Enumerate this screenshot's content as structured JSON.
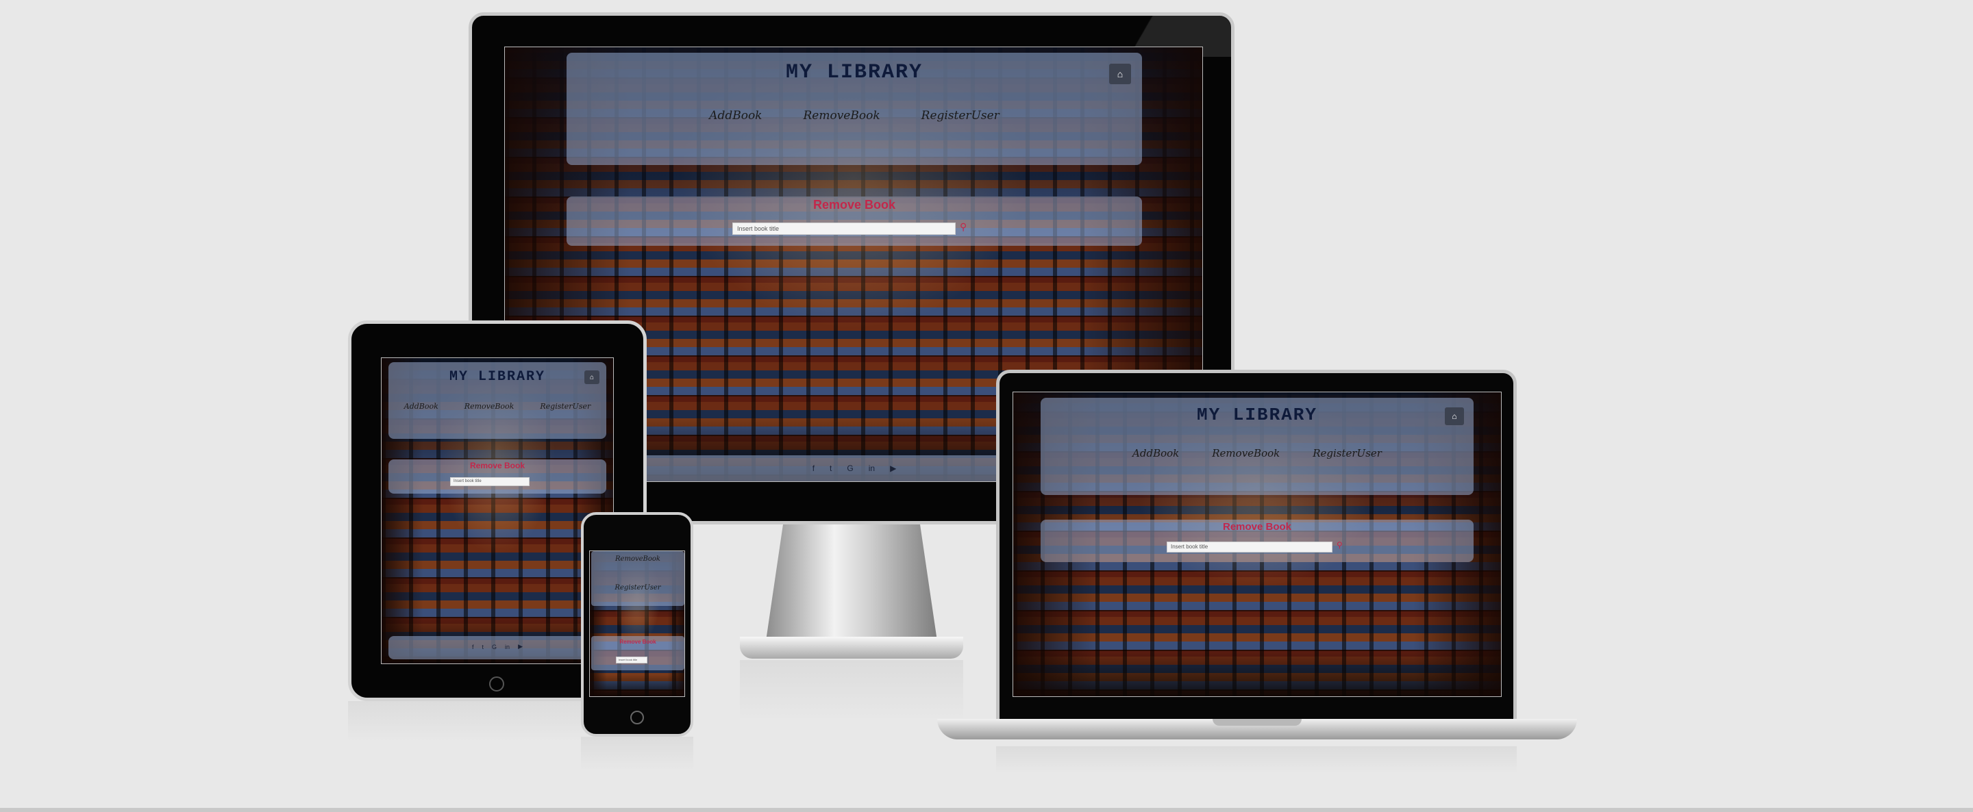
{
  "site": {
    "title": "MY LIBRARY",
    "nav": [
      "AddBook",
      "RemoveBook",
      "RegisterUser"
    ],
    "section_title": "Remove Book",
    "search_placeholder": "Insert book title"
  },
  "icons": {
    "home": "home-icon",
    "search": "search-icon",
    "social": [
      "facebook-icon",
      "twitter-icon",
      "google-icon",
      "linkedin-icon",
      "youtube-icon"
    ]
  },
  "colors": {
    "background": "#e8e8e8",
    "panel": "#96aacd",
    "title": "#0e1a3a",
    "accent": "#c2284b"
  }
}
